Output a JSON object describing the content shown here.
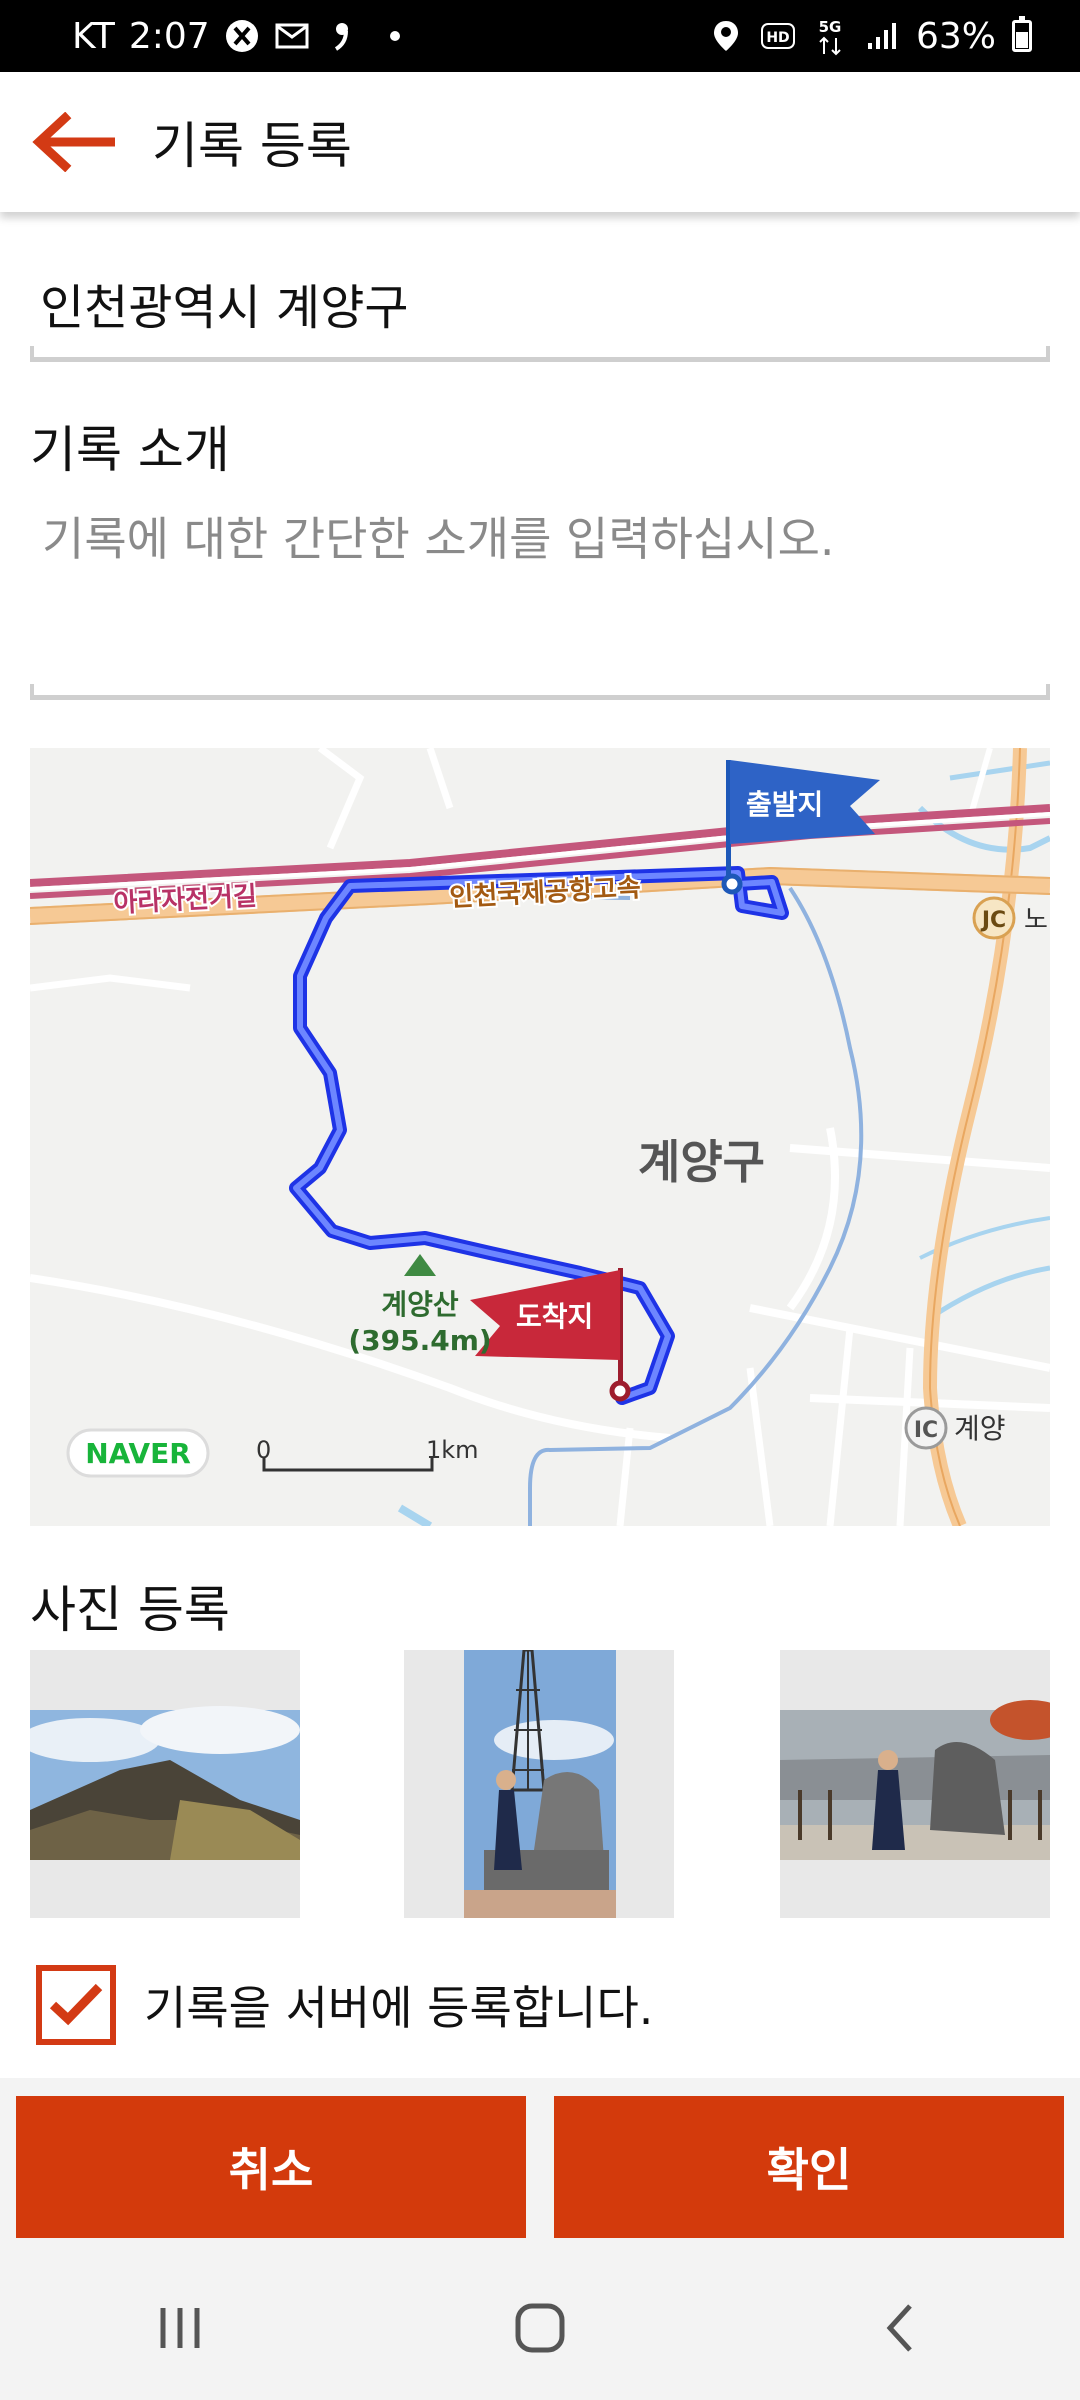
{
  "status_bar": {
    "carrier": "KT",
    "time": "2:07",
    "network": "5G",
    "battery": "63%",
    "battery_level": 0.63,
    "icons": [
      "x-app-icon",
      "mail-icon",
      "quote-icon",
      "dot-icon",
      "location-icon",
      "hd-icon",
      "5g-icon",
      "signal-icon",
      "battery-icon"
    ]
  },
  "header": {
    "back_icon": "arrow-left-icon",
    "title": "기록 등록"
  },
  "location": {
    "value": "인천광역시 계양구"
  },
  "intro": {
    "label": "기록 소개",
    "placeholder": "기록에 대한 간단한 소개를 입력하십시오."
  },
  "map": {
    "road_labels": [
      "아라자전거길",
      "인천국제공항고속"
    ],
    "district": "계양구",
    "start_flag": "출발지",
    "end_flag": "도착지",
    "peak_name": "계양산",
    "peak_height": "(395.4m)",
    "interchange_jc": "JC",
    "interchange_jc_label": "노",
    "interchange_ic": "IC",
    "interchange_ic_label": "계양",
    "brand": "NAVER",
    "scale_start": "0",
    "scale_end": "1km",
    "colors": {
      "route": "#2a4bf0",
      "start_flag": "#2e63c6",
      "end_flag": "#c8283a",
      "highway": "#f6c995",
      "brand": "#18b43a"
    }
  },
  "photos": {
    "label": "사진 등록",
    "items": [
      "mountain-photo",
      "tower-photo",
      "summit-photo"
    ]
  },
  "register": {
    "checked": true,
    "label": "기록을 서버에 등록합니다."
  },
  "buttons": {
    "cancel": "취소",
    "confirm": "확인",
    "color": "#d33a0c"
  },
  "nav": {
    "icons": [
      "recent-apps-icon",
      "home-icon",
      "back-icon"
    ]
  }
}
